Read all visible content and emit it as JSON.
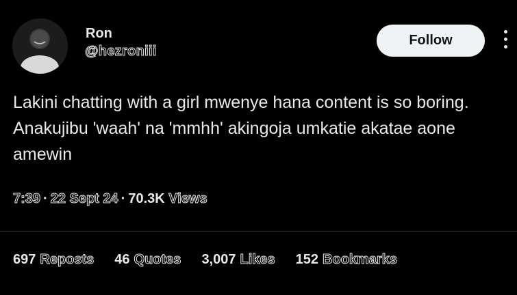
{
  "user": {
    "display_name": "Ron",
    "handle": "@hezroniii"
  },
  "follow_label": "Follow",
  "tweet": {
    "text": "Lakini chatting with a girl mwenye hana content is so boring. Anakujibu 'waah' na 'mmhh' akingoja umkatie akatae aone amewin"
  },
  "meta": {
    "time": "7:39",
    "date": "22 Sept 24",
    "views_count": "70.3K",
    "views_label": "Views",
    "separator": "·"
  },
  "stats": [
    {
      "count": "697",
      "label": "Reposts"
    },
    {
      "count": "46",
      "label": "Quotes"
    },
    {
      "count": "3,007",
      "label": "Likes"
    },
    {
      "count": "152",
      "label": "Bookmarks"
    }
  ],
  "colors": {
    "background": "#000000",
    "text": "#e7e9ea",
    "button_bg": "#eff3f4",
    "divider": "#2f3336"
  },
  "icons": [
    "avatar-photo",
    "more-options-icon"
  ]
}
